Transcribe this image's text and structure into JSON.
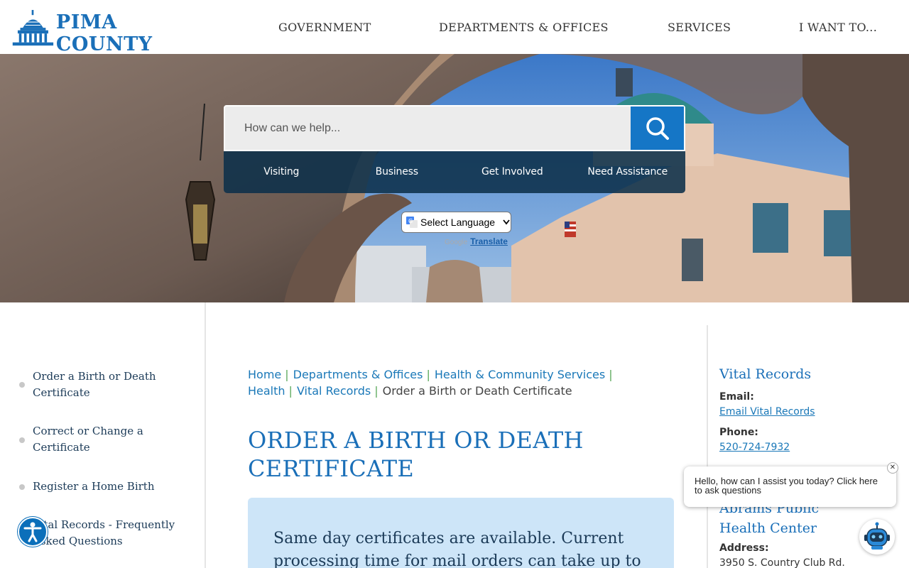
{
  "header": {
    "logo_text": "PIMA COUNTY",
    "nav": [
      "GOVERNMENT",
      "DEPARTMENTS & OFFICES",
      "SERVICES",
      "I WANT TO..."
    ]
  },
  "hero": {
    "search_placeholder": "How can we help...",
    "quicklinks": [
      "Visiting",
      "Business",
      "Get Involved",
      "Need Assistance"
    ],
    "language_select": "Select Language",
    "powered_by": "Google",
    "translate_label": "Translate"
  },
  "leftnav": {
    "items": [
      "Order a Birth or Death Certificate",
      "Correct or Change a Certificate",
      "Register a Home Birth",
      "Vital Records - Frequently Asked Questions"
    ]
  },
  "main": {
    "breadcrumb": [
      "Home",
      "Departments & Offices",
      "Health & Community Services",
      "Health",
      "Vital Records"
    ],
    "breadcrumb_current": "Order a Birth or Death Certificate",
    "title": "ORDER A BIRTH OR DEATH CERTIFICATE",
    "notice": "Same day certificates are available. Current processing time for mail orders can take up to 4-6"
  },
  "sidebar": {
    "title": "Vital Records",
    "email_label": "Email:",
    "email_link": "Email Vital Records",
    "phone_label": "Phone:",
    "phone_link": "520-724-7932",
    "center_title": "Abrams Public Health Center",
    "address_label": "Address:",
    "address_line": "3950 S. Country Club Rd."
  },
  "chat": {
    "message": "Hello, how can I assist you today? Click here to ask questions",
    "close_symbol": "✕"
  },
  "colors": {
    "brand_blue": "#1a6fb8",
    "search_button": "#1576c6",
    "quicklinks_bg": "#0d304a",
    "notice_bg": "#cde5f8"
  }
}
